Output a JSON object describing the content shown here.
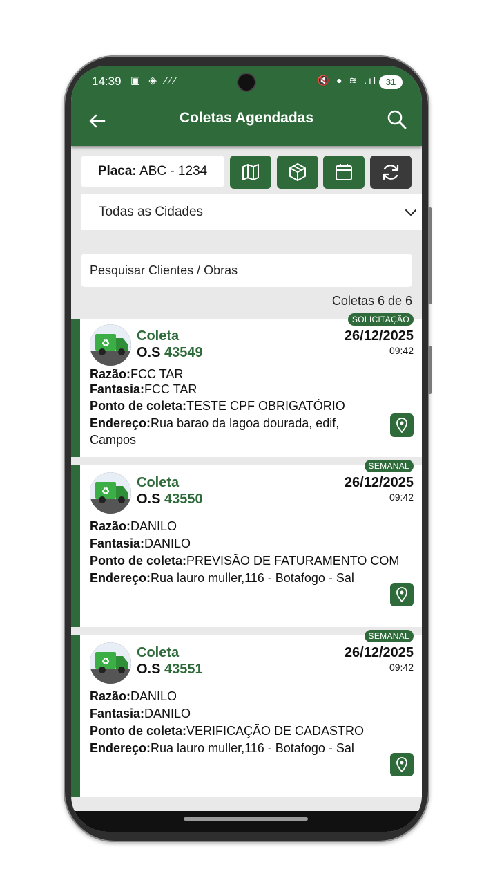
{
  "status": {
    "time": "14:39",
    "left_icons": "▣ ◈ ⁄⁄⁄",
    "right_icons": "🔇 ● ≋ .ıl",
    "battery": "31"
  },
  "appbar": {
    "title": "Coletas Agendadas"
  },
  "toolbar": {
    "placa_label": "Placa:",
    "placa_value": "ABC - 1234"
  },
  "city_select": {
    "value": "Todas as Cidades"
  },
  "search": {
    "placeholder": "Pesquisar Clientes / Obras"
  },
  "count": "Coletas 6 de 6",
  "labels": {
    "razao": "Razão:",
    "fantasia": "Fantasia:",
    "ponto": "Ponto de coleta:",
    "endereco": "Endereço:",
    "os_prefix": "O.S"
  },
  "cards": [
    {
      "badge": "SOLICITAÇÃO",
      "title": "Coleta",
      "os": "43549",
      "date": "26/12/2025",
      "time": "09:42",
      "razao": "FCC TAR",
      "fantasia": "FCC TAR",
      "ponto": "TESTE CPF OBRIGATÓRIO",
      "endereco": "Rua barao da lagoa dourada, edif, Campos"
    },
    {
      "badge": "SEMANAL",
      "title": "Coleta",
      "os": "43550",
      "date": "26/12/2025",
      "time": "09:42",
      "razao": "DANILO",
      "fantasia": "DANILO",
      "ponto": "PREVISÃO DE FATURAMENTO COM",
      "endereco": "Rua lauro muller,116 - Botafogo - Sal"
    },
    {
      "badge": "SEMANAL",
      "title": "Coleta",
      "os": "43551",
      "date": "26/12/2025",
      "time": "09:42",
      "razao": "DANILO",
      "fantasia": "DANILO",
      "ponto": "VERIFICAÇÃO DE CADASTRO",
      "endereco": "Rua lauro muller,116 - Botafogo - Sal"
    }
  ],
  "colors": {
    "primary": "#2f6b3a",
    "dark_button": "#3a3a3a",
    "background": "#e9e9e9"
  }
}
